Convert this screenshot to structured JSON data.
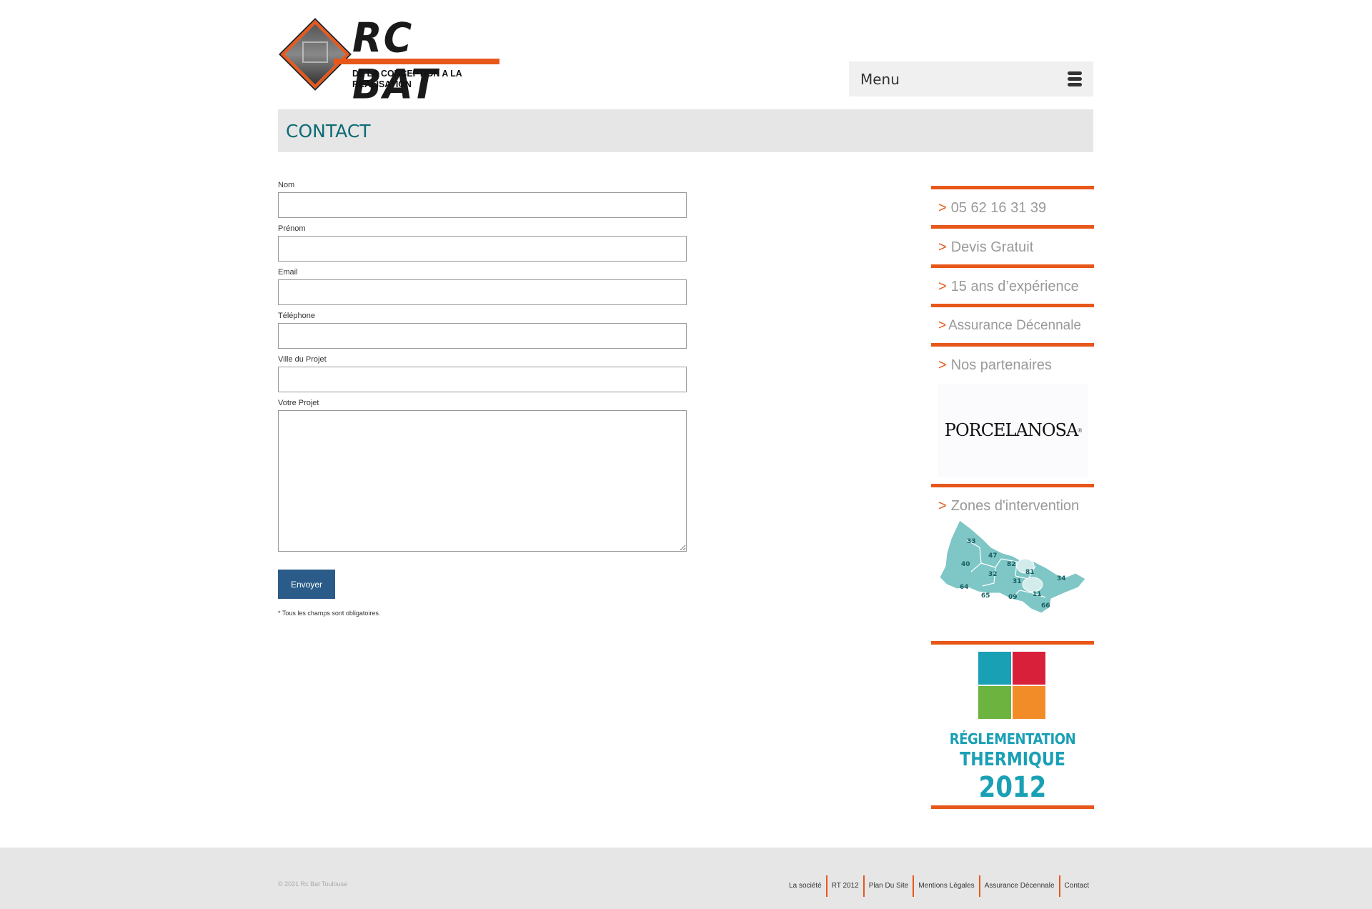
{
  "header": {
    "brand": "RC BAT",
    "tagline": "DE LA CONCEPTION A LA REALISATION",
    "menu_label": "Menu"
  },
  "page": {
    "title": "CONTACT"
  },
  "form": {
    "fields": [
      {
        "label": "Nom",
        "value": ""
      },
      {
        "label": "Prénom",
        "value": ""
      },
      {
        "label": "Email",
        "value": ""
      },
      {
        "label": "Téléphone",
        "value": ""
      },
      {
        "label": "Ville du Projet",
        "value": ""
      },
      {
        "label": "Votre Projet",
        "value": ""
      }
    ],
    "submit_label": "Envoyer",
    "note": "* Tous les champs sont obligatoires."
  },
  "sidebar": {
    "arrow": ">",
    "phone": "05 62 16 31 39",
    "quote": "Devis Gratuit",
    "experience": "15 ans d’expérience",
    "insurance": "Assurance Décennale",
    "partners": "Nos partenaires",
    "partner_logo": "PORCELANOSA",
    "zones": "Zones d'intervention",
    "zone_codes": [
      "33",
      "47",
      "40",
      "82",
      "81",
      "32",
      "31",
      "34",
      "64",
      "65",
      "09",
      "11",
      "66"
    ],
    "rt_line1": "RÉGLEMENTATION",
    "rt_line2": "THERMIQUE",
    "rt_year": "2012",
    "rt_colors": [
      "#1aa0b5",
      "#d8203a",
      "#6db33f",
      "#f28c28"
    ]
  },
  "footer": {
    "copyright": "© 2021 Rc Bat Toulouse",
    "links": [
      "La société",
      "RT 2012",
      "Plan Du Site",
      "Mentions Légales",
      "Assurance Décennale",
      "Contact"
    ]
  },
  "colors": {
    "accent": "#e8571a",
    "title": "#0d6b75",
    "button": "#2b5c89",
    "map": "#7fc6c6"
  }
}
